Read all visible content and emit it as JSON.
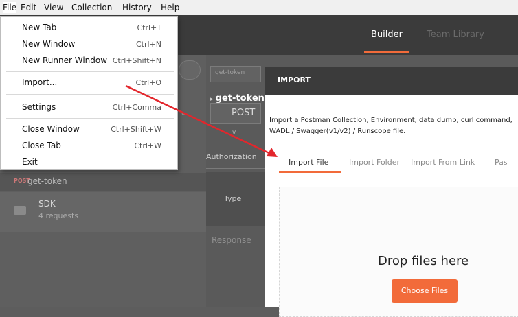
{
  "menubar": {
    "items": [
      "File",
      "Edit",
      "View",
      "Collection",
      "History",
      "Help"
    ]
  },
  "file_menu": {
    "items": [
      {
        "label": "New Tab",
        "shortcut": "Ctrl+T"
      },
      {
        "label": "New Window",
        "shortcut": "Ctrl+N"
      },
      {
        "label": "New Runner Window",
        "shortcut": "Ctrl+Shift+N"
      },
      {
        "label": "Import...",
        "shortcut": "Ctrl+O"
      },
      {
        "label": "Settings",
        "shortcut": "Ctrl+Comma"
      },
      {
        "label": "Close Window",
        "shortcut": "Ctrl+Shift+W"
      },
      {
        "label": "Close Tab",
        "shortcut": "Ctrl+W"
      },
      {
        "label": "Exit",
        "shortcut": ""
      }
    ]
  },
  "header": {
    "builder_tab": "Builder",
    "team_library_tab": "Team Library"
  },
  "sidebar": {
    "request_method": "POST",
    "request_name": "get-token",
    "collection_name": "SDK",
    "collection_count": "4 requests"
  },
  "main": {
    "tab_input": "get-token",
    "request_title": "get-token",
    "method": "POST",
    "auth_tab": "Authorization",
    "type_label": "Type",
    "response_label": "Response"
  },
  "import_modal": {
    "title": "IMPORT",
    "description_line1": "Import a Postman Collection, Environment, data dump, curl command,",
    "description_line2": "WADL / Swagger(v1/v2) / Runscope file.",
    "tabs": [
      "Import File",
      "Import Folder",
      "Import From Link",
      "Pas"
    ],
    "drop_text": "Drop files here",
    "choose_button": "Choose Files"
  },
  "colors": {
    "accent": "#f26b3a",
    "annotation_arrow": "#e3262c"
  }
}
